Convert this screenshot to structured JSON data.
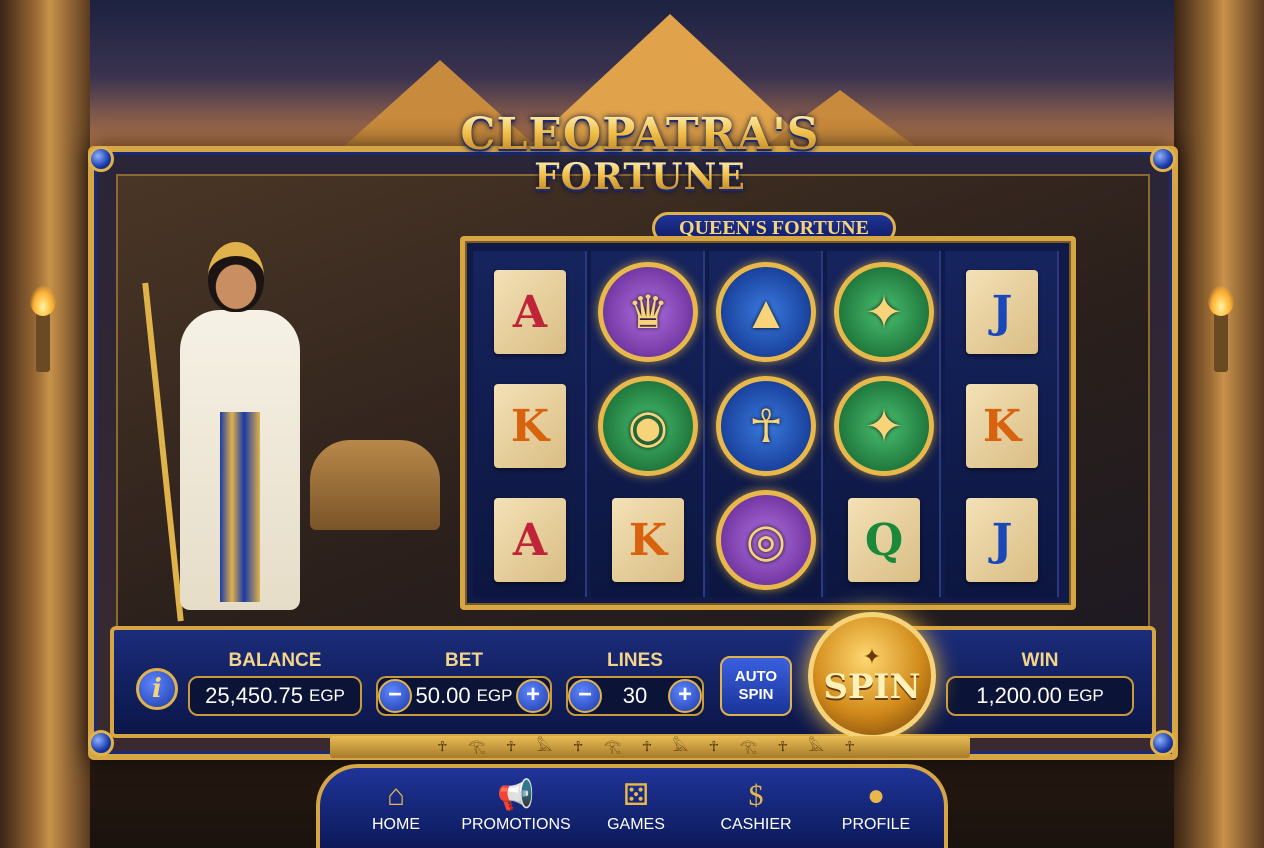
{
  "game": {
    "title_line1": "CLEOPATRA'S",
    "title_line2": "FORTUNE",
    "subtitle": "QUEEN'S FORTUNE"
  },
  "reels": [
    [
      {
        "type": "card",
        "value": "A"
      },
      {
        "type": "card",
        "value": "K"
      },
      {
        "type": "card",
        "value": "A"
      }
    ],
    [
      {
        "type": "coin",
        "icon": "cleopatra-icon",
        "color": "purple"
      },
      {
        "type": "coin",
        "icon": "eye-of-horus-icon",
        "color": "green"
      },
      {
        "type": "card",
        "value": "K"
      }
    ],
    [
      {
        "type": "coin",
        "icon": "anubis-icon",
        "color": "blue"
      },
      {
        "type": "coin",
        "icon": "ankh-icon",
        "color": "blue"
      },
      {
        "type": "coin",
        "icon": "gold-coins-icon",
        "color": "purple"
      }
    ],
    [
      {
        "type": "coin",
        "icon": "scarab-icon",
        "color": "green"
      },
      {
        "type": "coin",
        "icon": "scarab-icon",
        "color": "green"
      },
      {
        "type": "card",
        "value": "Q"
      }
    ],
    [
      {
        "type": "card",
        "value": "J"
      },
      {
        "type": "card",
        "value": "K"
      },
      {
        "type": "card",
        "value": "J"
      }
    ]
  ],
  "controls": {
    "info_label": "i",
    "balance_label": "BALANCE",
    "balance_value": "25,450.75",
    "balance_unit": "EGP",
    "bet_label": "BET",
    "bet_value": "50.00",
    "bet_unit": "EGP",
    "lines_label": "LINES",
    "lines_value": "30",
    "minus": "−",
    "plus": "+",
    "auto_line1": "AUTO",
    "auto_line2": "SPIN",
    "spin_label": "SPIN",
    "win_label": "WIN",
    "win_value": "1,200.00",
    "win_unit": "EGP"
  },
  "nav": {
    "items": [
      {
        "label": "HOME",
        "icon": "home-icon"
      },
      {
        "label": "PROMOTIONS",
        "icon": "megaphone-icon"
      },
      {
        "label": "GAMES",
        "icon": "dice-icon"
      },
      {
        "label": "CASHIER",
        "icon": "cashier-icon"
      },
      {
        "label": "PROFILE",
        "icon": "profile-icon"
      }
    ]
  },
  "colors": {
    "gold": "#d6a544",
    "royal_blue": "#1b2c7a",
    "card_red": "#c02438",
    "card_orange": "#d8620e",
    "card_blue": "#1a48b8",
    "card_green": "#1a8a3a"
  }
}
